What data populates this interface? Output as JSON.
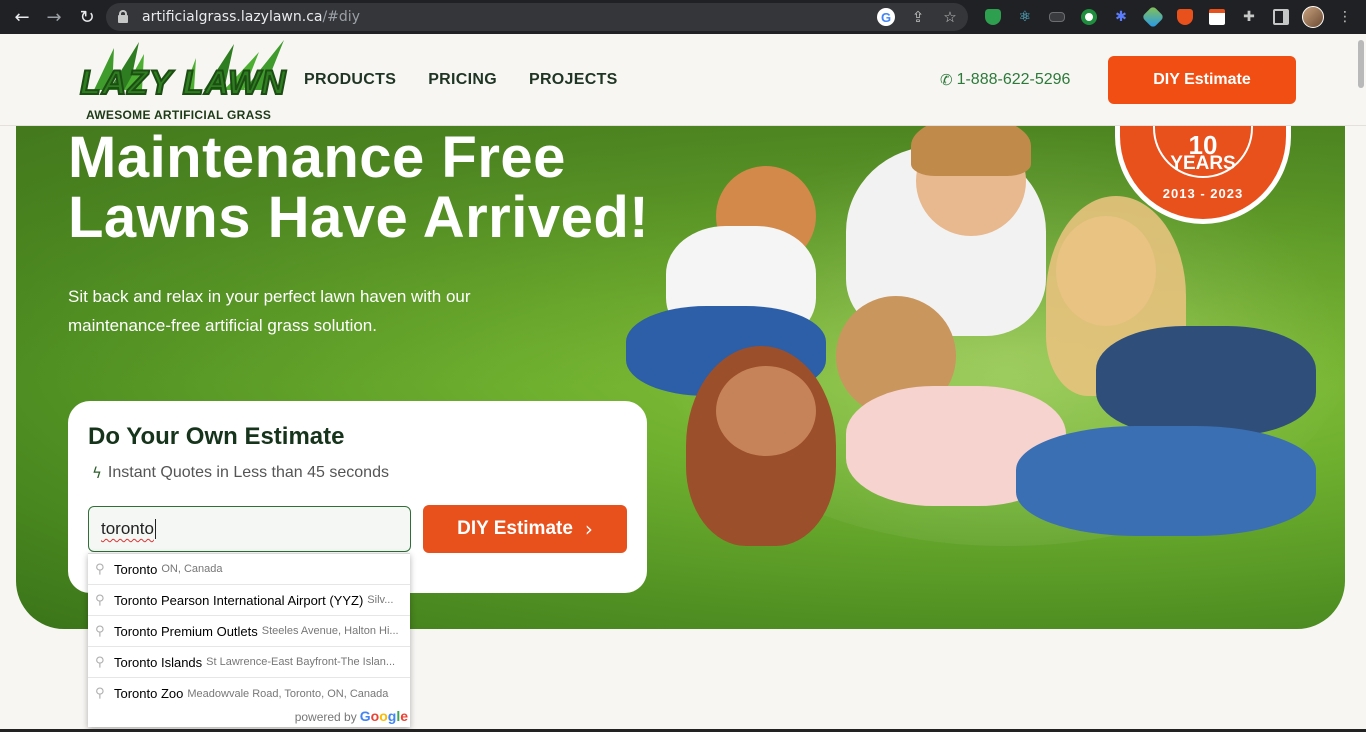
{
  "browser": {
    "back_icon": "←",
    "forward_icon": "→",
    "reload_icon": "↻",
    "url_host": "artificialgrass.lazylawn.ca",
    "url_path": "/#diy",
    "omnibox_icons": [
      "google-icon",
      "share-icon",
      "star-icon"
    ],
    "extensions": [
      "shield-extension",
      "react-extension",
      "media-extension",
      "circle-extension",
      "gear-extension",
      "tree-extension",
      "fox-extension",
      "note-extension",
      "puzzle-icon",
      "sidebar-icon"
    ]
  },
  "header": {
    "logo_text": "LAZY LAWN",
    "logo_tagline": "AWESOME ARTIFICIAL GRASS",
    "nav": [
      {
        "label": "PRODUCTS"
      },
      {
        "label": "PRICING"
      },
      {
        "label": "PROJECTS"
      }
    ],
    "phone": "1-888-622-5296",
    "cta_label": "DIY Estimate"
  },
  "hero": {
    "title_line1": "Maintenance Free",
    "title_line2": "Lawns Have Arrived!",
    "subtitle": "Sit back and relax in your perfect lawn haven with our maintenance-free artificial grass solution.",
    "badge_number": "10",
    "badge_years": "YEARS",
    "badge_range": "2013 - 2023"
  },
  "estimate": {
    "title": "Do Your Own Estimate",
    "subtitle": "Instant Quotes in Less than 45 seconds",
    "input_value": "toronto",
    "button_label": "DIY Estimate"
  },
  "autocomplete": {
    "items": [
      {
        "main": "Toronto",
        "secondary": "ON, Canada"
      },
      {
        "main": "Toronto Pearson International Airport (YYZ)",
        "secondary": "Silv..."
      },
      {
        "main": "Toronto Premium Outlets",
        "secondary": "Steeles Avenue, Halton Hi..."
      },
      {
        "main": "Toronto Islands",
        "secondary": "St Lawrence-East Bayfront-The Islan..."
      },
      {
        "main": "Toronto Zoo",
        "secondary": "Meadowvale Road, Toronto, ON, Canada"
      }
    ],
    "powered_by": "powered by",
    "google": "Google"
  },
  "colors": {
    "brand_orange": "#f04e12",
    "brand_green": "#2c7a3a",
    "nav_text": "#1f3524"
  }
}
